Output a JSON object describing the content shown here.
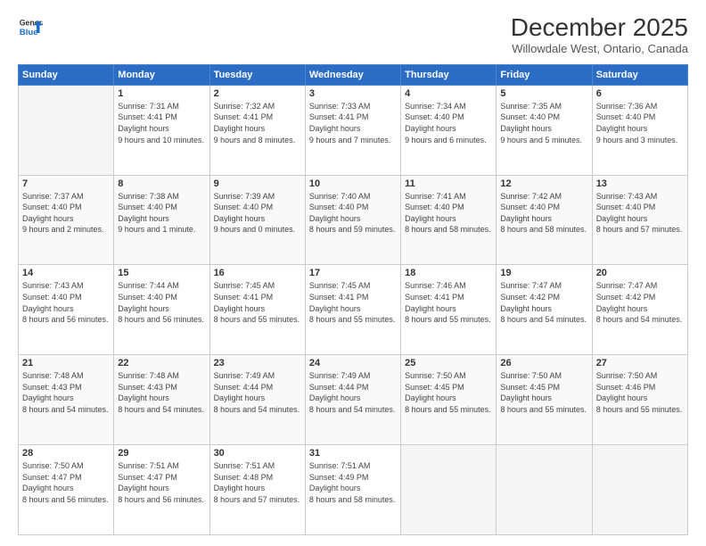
{
  "header": {
    "logo_line1": "General",
    "logo_line2": "Blue",
    "title": "December 2025",
    "subtitle": "Willowdale West, Ontario, Canada"
  },
  "calendar": {
    "days_of_week": [
      "Sunday",
      "Monday",
      "Tuesday",
      "Wednesday",
      "Thursday",
      "Friday",
      "Saturday"
    ],
    "weeks": [
      [
        {
          "num": "",
          "empty": true
        },
        {
          "num": "1",
          "sunrise": "7:31 AM",
          "sunset": "4:41 PM",
          "daylight": "9 hours and 10 minutes."
        },
        {
          "num": "2",
          "sunrise": "7:32 AM",
          "sunset": "4:41 PM",
          "daylight": "9 hours and 8 minutes."
        },
        {
          "num": "3",
          "sunrise": "7:33 AM",
          "sunset": "4:41 PM",
          "daylight": "9 hours and 7 minutes."
        },
        {
          "num": "4",
          "sunrise": "7:34 AM",
          "sunset": "4:40 PM",
          "daylight": "9 hours and 6 minutes."
        },
        {
          "num": "5",
          "sunrise": "7:35 AM",
          "sunset": "4:40 PM",
          "daylight": "9 hours and 5 minutes."
        },
        {
          "num": "6",
          "sunrise": "7:36 AM",
          "sunset": "4:40 PM",
          "daylight": "9 hours and 3 minutes."
        }
      ],
      [
        {
          "num": "7",
          "sunrise": "7:37 AM",
          "sunset": "4:40 PM",
          "daylight": "9 hours and 2 minutes."
        },
        {
          "num": "8",
          "sunrise": "7:38 AM",
          "sunset": "4:40 PM",
          "daylight": "9 hours and 1 minute."
        },
        {
          "num": "9",
          "sunrise": "7:39 AM",
          "sunset": "4:40 PM",
          "daylight": "9 hours and 0 minutes."
        },
        {
          "num": "10",
          "sunrise": "7:40 AM",
          "sunset": "4:40 PM",
          "daylight": "8 hours and 59 minutes."
        },
        {
          "num": "11",
          "sunrise": "7:41 AM",
          "sunset": "4:40 PM",
          "daylight": "8 hours and 58 minutes."
        },
        {
          "num": "12",
          "sunrise": "7:42 AM",
          "sunset": "4:40 PM",
          "daylight": "8 hours and 58 minutes."
        },
        {
          "num": "13",
          "sunrise": "7:43 AM",
          "sunset": "4:40 PM",
          "daylight": "8 hours and 57 minutes."
        }
      ],
      [
        {
          "num": "14",
          "sunrise": "7:43 AM",
          "sunset": "4:40 PM",
          "daylight": "8 hours and 56 minutes."
        },
        {
          "num": "15",
          "sunrise": "7:44 AM",
          "sunset": "4:40 PM",
          "daylight": "8 hours and 56 minutes."
        },
        {
          "num": "16",
          "sunrise": "7:45 AM",
          "sunset": "4:41 PM",
          "daylight": "8 hours and 55 minutes."
        },
        {
          "num": "17",
          "sunrise": "7:45 AM",
          "sunset": "4:41 PM",
          "daylight": "8 hours and 55 minutes."
        },
        {
          "num": "18",
          "sunrise": "7:46 AM",
          "sunset": "4:41 PM",
          "daylight": "8 hours and 55 minutes."
        },
        {
          "num": "19",
          "sunrise": "7:47 AM",
          "sunset": "4:42 PM",
          "daylight": "8 hours and 54 minutes."
        },
        {
          "num": "20",
          "sunrise": "7:47 AM",
          "sunset": "4:42 PM",
          "daylight": "8 hours and 54 minutes."
        }
      ],
      [
        {
          "num": "21",
          "sunrise": "7:48 AM",
          "sunset": "4:43 PM",
          "daylight": "8 hours and 54 minutes."
        },
        {
          "num": "22",
          "sunrise": "7:48 AM",
          "sunset": "4:43 PM",
          "daylight": "8 hours and 54 minutes."
        },
        {
          "num": "23",
          "sunrise": "7:49 AM",
          "sunset": "4:44 PM",
          "daylight": "8 hours and 54 minutes."
        },
        {
          "num": "24",
          "sunrise": "7:49 AM",
          "sunset": "4:44 PM",
          "daylight": "8 hours and 54 minutes."
        },
        {
          "num": "25",
          "sunrise": "7:50 AM",
          "sunset": "4:45 PM",
          "daylight": "8 hours and 55 minutes."
        },
        {
          "num": "26",
          "sunrise": "7:50 AM",
          "sunset": "4:45 PM",
          "daylight": "8 hours and 55 minutes."
        },
        {
          "num": "27",
          "sunrise": "7:50 AM",
          "sunset": "4:46 PM",
          "daylight": "8 hours and 55 minutes."
        }
      ],
      [
        {
          "num": "28",
          "sunrise": "7:50 AM",
          "sunset": "4:47 PM",
          "daylight": "8 hours and 56 minutes."
        },
        {
          "num": "29",
          "sunrise": "7:51 AM",
          "sunset": "4:47 PM",
          "daylight": "8 hours and 56 minutes."
        },
        {
          "num": "30",
          "sunrise": "7:51 AM",
          "sunset": "4:48 PM",
          "daylight": "8 hours and 57 minutes."
        },
        {
          "num": "31",
          "sunrise": "7:51 AM",
          "sunset": "4:49 PM",
          "daylight": "8 hours and 58 minutes."
        },
        {
          "num": "",
          "empty": true
        },
        {
          "num": "",
          "empty": true
        },
        {
          "num": "",
          "empty": true
        }
      ]
    ]
  }
}
